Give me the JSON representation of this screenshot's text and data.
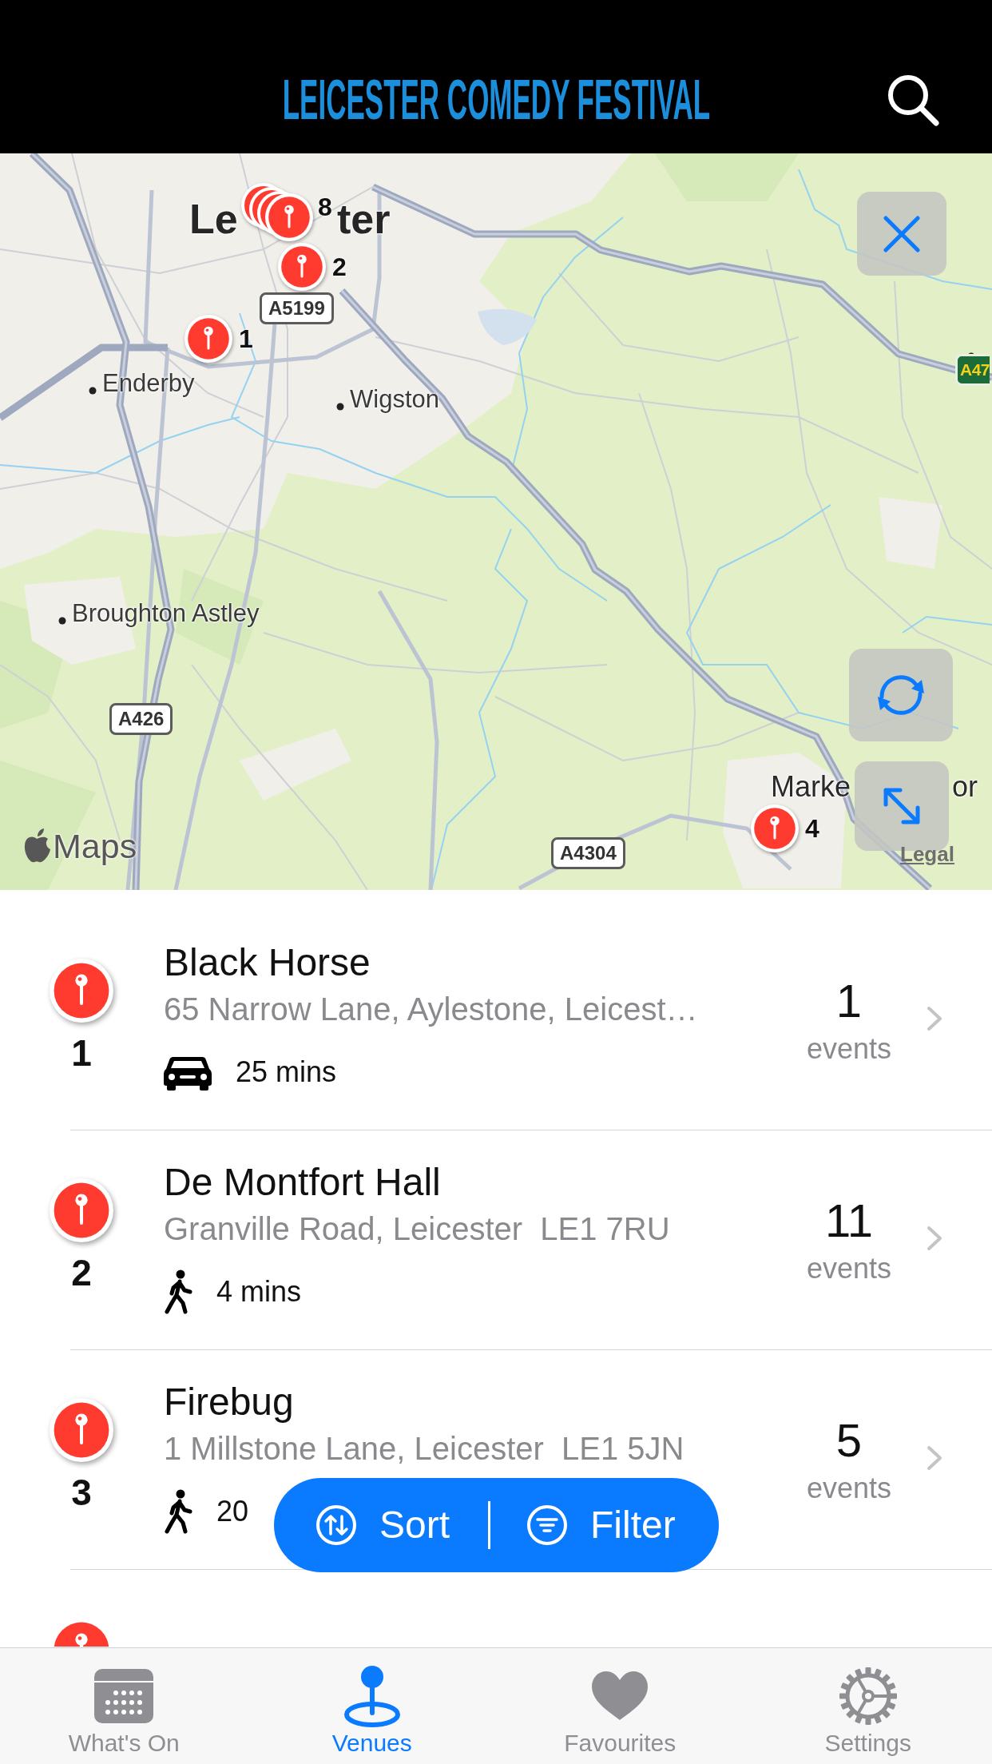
{
  "header": {
    "logo": "LEICESTER COMEDY FESTIVAL"
  },
  "map": {
    "places": [
      {
        "name": "Le",
        "kind": "city"
      },
      {
        "name": "ter",
        "kind": "city"
      },
      {
        "name": "Enderby",
        "kind": "town"
      },
      {
        "name": "Wigston",
        "kind": "town"
      },
      {
        "name": "Broughton Astley",
        "kind": "town"
      },
      {
        "name": "Marke",
        "kind": "district"
      },
      {
        "name": "or",
        "kind": "district"
      }
    ],
    "roads": [
      {
        "label": "A5199",
        "kind": "local"
      },
      {
        "label": "A47",
        "kind": "primary"
      },
      {
        "label": "A426",
        "kind": "local"
      },
      {
        "label": "A4304",
        "kind": "local"
      }
    ],
    "pins": [
      {
        "label": "8",
        "kind": "stack"
      },
      {
        "label": "2",
        "kind": "single"
      },
      {
        "label": "1",
        "kind": "single"
      },
      {
        "label": "4",
        "kind": "single"
      }
    ],
    "attribution": "Maps",
    "legal": "Legal"
  },
  "venues": [
    {
      "kind": "full",
      "number": "1",
      "name": "Black Horse",
      "address": "65 Narrow Lane, Aylestone, Leicest…",
      "travel": {
        "kind": "drive",
        "time": "25 mins"
      },
      "count": "1",
      "count_label": "events"
    },
    {
      "kind": "full",
      "number": "2",
      "name": "De Montfort Hall",
      "address": "Granville Road, Leicester  LE1 7RU",
      "travel": {
        "kind": "walk",
        "time": "4 mins"
      },
      "count": "11",
      "count_label": "events"
    },
    {
      "kind": "full",
      "number": "3",
      "name": "Firebug",
      "address": "1 Millstone Lane, Leicester  LE1 5JN",
      "travel": {
        "kind": "walk",
        "time": "20"
      },
      "count": "5",
      "count_label": "events"
    },
    {
      "kind": "peek"
    }
  ],
  "actions": [
    {
      "label": "Sort"
    },
    {
      "label": "Filter"
    }
  ],
  "tabs": [
    {
      "label": "What's On",
      "selected": false
    },
    {
      "label": "Venues",
      "selected": true
    },
    {
      "label": "Favourites",
      "selected": false
    },
    {
      "label": "Settings",
      "selected": false
    }
  ]
}
